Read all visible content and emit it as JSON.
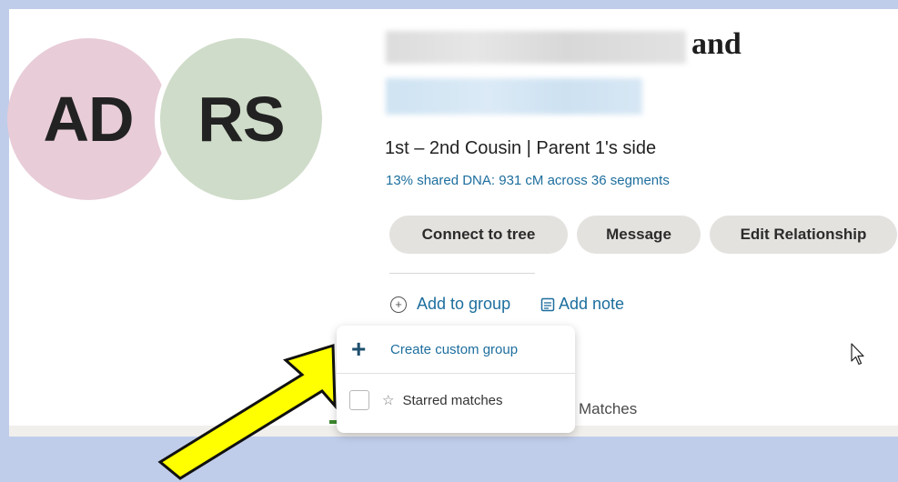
{
  "avatars": {
    "first_initials": "AD",
    "second_initials": "RS"
  },
  "match": {
    "name_connector": "and",
    "relationship": "1st – 2nd Cousin | Parent 1's side",
    "shared_dna": "13% shared DNA: 931 cM across 36 segments"
  },
  "actions": {
    "connect_label": "Connect to tree",
    "message_label": "Message",
    "edit_label": "Edit Relationship"
  },
  "links": {
    "add_group_label": "Add to group",
    "add_note_label": "Add note"
  },
  "dropdown": {
    "create_label": "Create custom group",
    "starred_label": "Starred matches"
  },
  "tabs": {
    "matches_label": "Matches"
  },
  "colors": {
    "accent_blue": "#1d6e9e",
    "avatar_pink": "#e8ccd8",
    "avatar_green": "#cfdcc9",
    "highlight_arrow": "#ffff00"
  }
}
